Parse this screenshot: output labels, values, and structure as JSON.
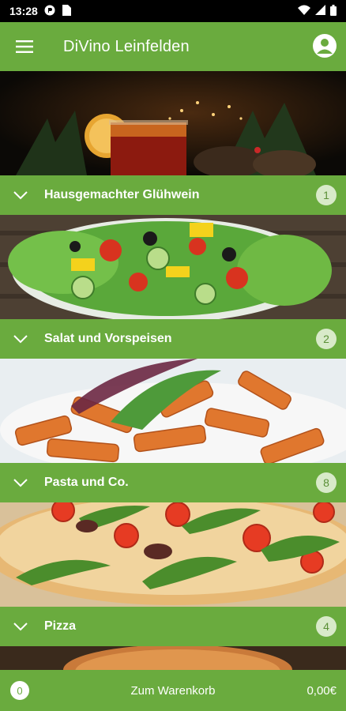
{
  "status_bar": {
    "time": "13:28",
    "icons": [
      "app-notification-icon",
      "sim-card-icon",
      "wifi-icon",
      "signal-icon",
      "battery-icon"
    ]
  },
  "app_bar": {
    "title": "DiVino Leinfelden",
    "menu_icon": "hamburger-menu-icon",
    "account_icon": "account-icon"
  },
  "categories": [
    {
      "label": "Hausgemachter Glühwein",
      "count": "1",
      "image": "mulled-wine-photo"
    },
    {
      "label": "Salat und Vorspeisen",
      "count": "2",
      "image": "salad-photo"
    },
    {
      "label": "Pasta und Co.",
      "count": "8",
      "image": "pasta-photo"
    },
    {
      "label": "Pizza",
      "count": "4",
      "image": "pizza-photo"
    }
  ],
  "cart": {
    "count": "0",
    "label": "Zum Warenkorb",
    "total": "0,00€"
  },
  "colors": {
    "brand_green": "#6aab3e",
    "badge_bg": "#d8eac9",
    "status_bar": "#000000"
  }
}
